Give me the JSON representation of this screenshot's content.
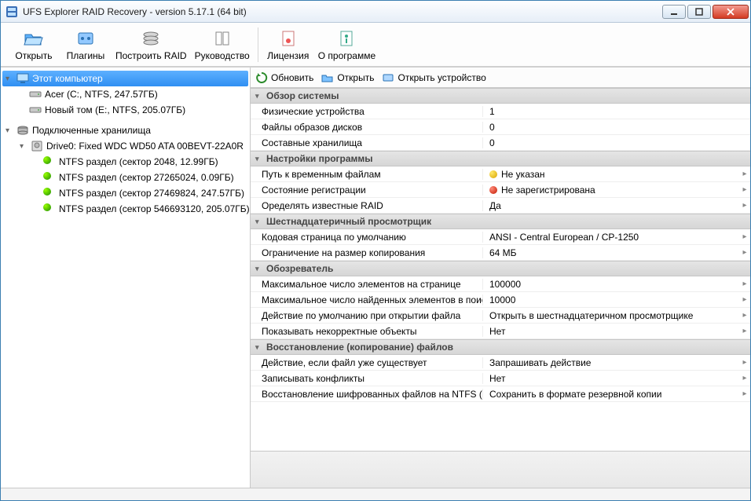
{
  "window": {
    "title": "UFS Explorer RAID Recovery - version 5.17.1 (64 bit)"
  },
  "toolbar": {
    "open": "Открыть",
    "plugins": "Плагины",
    "build_raid": "Построить RAID",
    "manual": "Руководство",
    "license": "Лицензия",
    "about": "О программе"
  },
  "subtoolbar": {
    "refresh": "Обновить",
    "open": "Открыть",
    "open_device": "Открыть устройство"
  },
  "tree": {
    "this_computer": "Этот компьютер",
    "vol_acer": "Acer (C:, NTFS, 247.57ГБ)",
    "vol_new": "Новый том (E:, NTFS, 205.07ГБ)",
    "connected": "Подключенные хранилища",
    "drive0": "Drive0: Fixed WDC WD50 ATA 00BEVT-22A0R",
    "p1": "NTFS раздел (сектор 2048, 12.99ГБ)",
    "p2": "NTFS раздел (сектор 27265024, 0.09ГБ)",
    "p3": "NTFS раздел (сектор 27469824, 247.57ГБ)",
    "p4": "NTFS раздел (сектор 546693120, 205.07ГБ)"
  },
  "groups": {
    "overview": "Обзор системы",
    "settings": "Настройки программы",
    "hex": "Шестнадцатеричный просмотрщик",
    "browser": "Обозреватель",
    "recovery": "Восстановление (копирование) файлов"
  },
  "rows": {
    "phys_dev": {
      "k": "Физические устройства",
      "v": "1"
    },
    "img_files": {
      "k": "Файлы образов дисков",
      "v": "0"
    },
    "comp_stor": {
      "k": "Составные хранилища",
      "v": "0"
    },
    "tmp_path": {
      "k": "Путь к временным файлам",
      "v": "Не указан"
    },
    "reg_state": {
      "k": "Состояние регистрации",
      "v": "Не зарегистрирована"
    },
    "known_raid": {
      "k": "Оределять известные RAID",
      "v": "Да"
    },
    "codepage": {
      "k": "Кодовая страница по умолчанию",
      "v": "ANSI - Central European / CP-1250"
    },
    "copy_limit": {
      "k": "Ограничение на размер копирования",
      "v": "64 МБ"
    },
    "max_page": {
      "k": "Максимальное число элементов на странице",
      "v": "100000"
    },
    "max_found": {
      "k": "Максимальное число найденных элементов в поиске",
      "v": "10000"
    },
    "default_open": {
      "k": "Действие по умолчанию при открытии файла",
      "v": "Открыть в шестнадцатеричном просмотрщике"
    },
    "show_bad": {
      "k": "Показывать некорректные объекты",
      "v": "Нет"
    },
    "if_exists": {
      "k": "Действие, если файл уже существует",
      "v": "Запрашивать действие"
    },
    "log_confl": {
      "k": "Записывать конфликты",
      "v": "Нет"
    },
    "efs": {
      "k": "Восстановление шифрованных файлов на NTFS (EFS)",
      "v": "Сохранить в формате резервной копии"
    }
  }
}
